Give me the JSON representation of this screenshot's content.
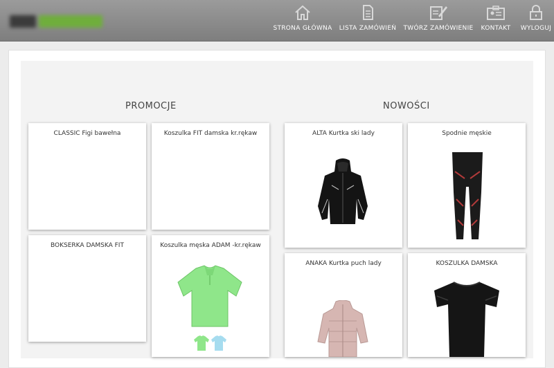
{
  "nav": {
    "items": [
      {
        "label": "STRONA GŁÓWNA",
        "icon": "home-icon"
      },
      {
        "label": "LISTA ZAMÓWIEŃ",
        "icon": "document-icon"
      },
      {
        "label": "TWÓRZ ZAMÓWIENIE",
        "icon": "edit-form-icon"
      },
      {
        "label": "KONTAKT",
        "icon": "contact-card-icon"
      },
      {
        "label": "WYLOGUJ",
        "icon": "lock-icon"
      }
    ]
  },
  "sections": {
    "promocje": {
      "title": "PROMOCJE",
      "products": [
        {
          "name": "CLASSIC Figi bawełna"
        },
        {
          "name": "Koszulka FIT damska kr.rękaw"
        },
        {
          "name": "BOKSERKA DAMSKA FIT"
        },
        {
          "name": "Koszulka męska ADAM -kr.rękaw"
        }
      ]
    },
    "nowosci": {
      "title": "NOWOŚCI",
      "products": [
        {
          "name": "ALTA Kurtka ski lady"
        },
        {
          "name": "Spodnie męskie"
        },
        {
          "name": "ANAKA Kurtka puch lady"
        },
        {
          "name": "KOSZULKA DAMSKA"
        }
      ]
    }
  },
  "colors": {
    "header": "#8a8a8a",
    "logo_green": "#6fae3c",
    "shirt_green": "#8fe68a",
    "shirt_blue": "#a6dcef",
    "jacket_pink": "#d6b6b2",
    "pants_accent": "#b23a3a"
  }
}
